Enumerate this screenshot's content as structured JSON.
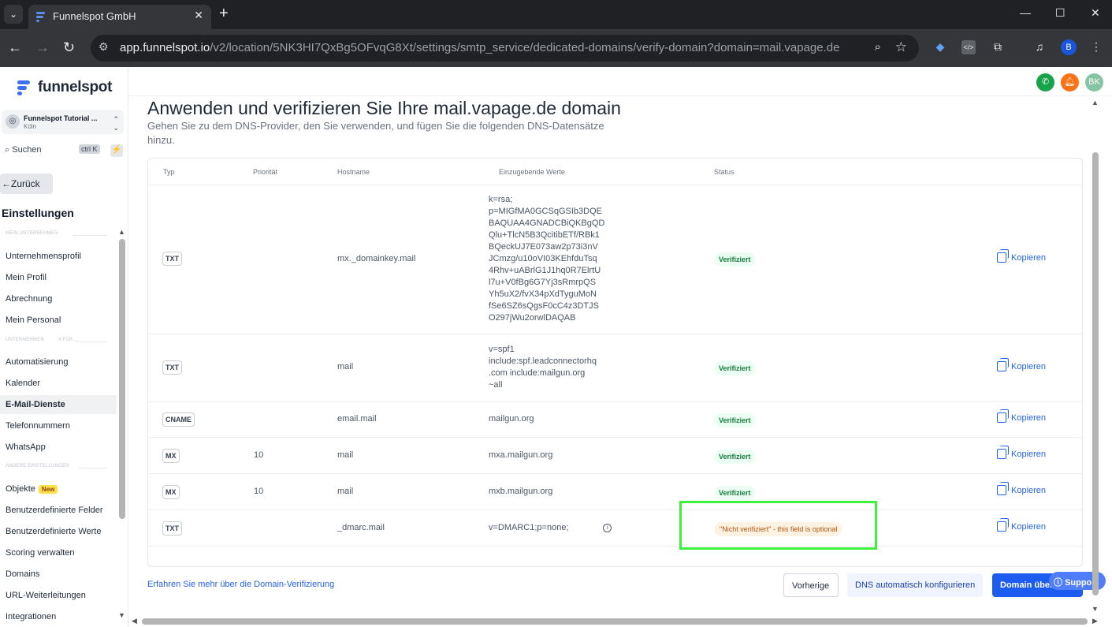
{
  "browser": {
    "tab_title": "Funnelspot GmbH",
    "url_host": "app.funnelspot.io",
    "url_path": "/v2/location/5NK3HI7QxBg5OFvqG8Xt/settings/smtp_service/dedicated-domains/verify-domain?domain=mail.vapage.de",
    "profile_initial": "B"
  },
  "sidebar": {
    "logo_text": "funnelspot",
    "location_name": "Funnelspot Tutorial ...",
    "location_city": "Köln",
    "search_label": "Suchen",
    "search_shortcut": "ctrl K",
    "back_label": "Zurück",
    "section_title": "Einstellungen",
    "group_1": "MEIN UNTERNEHMEN",
    "group_2a": "UNTERNEHMEN",
    "group_2b": "4 FÜR...",
    "group_3": "ANDERE EINSTELLUNGEN",
    "items_group1": [
      "Unternehmensprofil",
      "Mein Profil",
      "Abrechnung",
      "Mein Personal"
    ],
    "items_group2": [
      "Automatisierung",
      "Kalender",
      "E-Mail-Dienste",
      "Telefonnummern",
      "WhatsApp"
    ],
    "items_group3": [
      "Objekte",
      "Benutzerdefinierte Felder",
      "Benutzerdefinierte Werte",
      "Scoring verwalten",
      "Domains",
      "URL-Weiterleitungen",
      "Integrationen"
    ],
    "new_badge": "New"
  },
  "header": {
    "user_initials": "BK"
  },
  "main": {
    "title": "Anwenden und verifizieren Sie Ihre mail.vapage.de domain",
    "subtitle": "Gehen Sie zu dem DNS-Provider, den Sie verwenden, und fügen Sie die folgenden DNS-Datensätze hinzu.",
    "columns": [
      "Typ",
      "Priorität",
      "Hostname",
      "Einzugebende Werte",
      "Status"
    ],
    "copy_label": "Kopieren",
    "rows": [
      {
        "type": "TXT",
        "priority": "",
        "hostname": "mx._domainkey.mail",
        "value": "k=rsa;\np=MIGfMA0GCSqGSIb3DQE\nBAQUAA4GNADCBiQKBgQD\nQlu+TlcN5B3QcitibETf/RBk1\nBQeckUJ7E073aw2p73i3nV\nJCmzg/u10oVI03KEhfduTsq\n4Rhv+uABrlG1J1hq0R7ElrtU\nl7u+V0fBg6G7Yj3sRmrpQS\nYh5uX2/fvX34pXdTyguMoN\nfSe6SZ6sQgsF0cC4z3DTJS\nO297jWu2orwlDAQAB",
        "status": "Verifiziert"
      },
      {
        "type": "TXT",
        "priority": "",
        "hostname": "mail",
        "value": "v=spf1\ninclude:spf.leadconnectorhq\n.com include:mailgun.org\n~all",
        "status": "Verifiziert"
      },
      {
        "type": "CNAME",
        "priority": "",
        "hostname": "email.mail",
        "value": "mailgun.org",
        "status": "Verifiziert"
      },
      {
        "type": "MX",
        "priority": "10",
        "hostname": "mail",
        "value": "mxa.mailgun.org",
        "status": "Verifiziert"
      },
      {
        "type": "MX",
        "priority": "10",
        "hostname": "mail",
        "value": "mxb.mailgun.org",
        "status": "Verifiziert"
      },
      {
        "type": "TXT",
        "priority": "",
        "hostname": "_dmarc.mail",
        "value": "v=DMARC1;p=none;",
        "status": "\"Nicht verifiziert\" - this field is optional"
      }
    ],
    "learn_more": "Erfahren Sie mehr über die Domain-Verifizierung",
    "btn_prev": "Vorherige",
    "btn_dns": "DNS automatisch konfigurieren",
    "btn_domain": "Domain über...",
    "support": "Support"
  },
  "colors": {
    "accent": "#1d5cf0",
    "verified_bg": "#ecfdf3",
    "verified_text": "#15803d",
    "warn_text": "#b45309",
    "highlight": "#3cf23c"
  }
}
